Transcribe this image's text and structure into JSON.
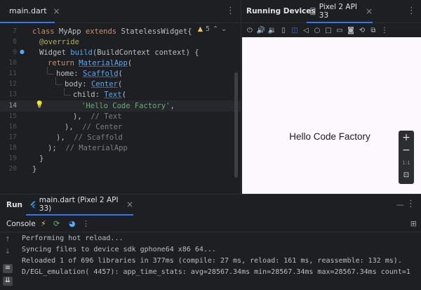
{
  "editor": {
    "tab_label": "main.dart",
    "warnings_count": "5",
    "line_numbers": [
      "7",
      "8",
      "9",
      "10",
      "11",
      "12",
      "13",
      "14",
      "15",
      "16",
      "17",
      "18",
      "19",
      "20"
    ],
    "current_line": "14",
    "lines": {
      "l7_kw1": "class",
      "l7_name": " MyApp ",
      "l7_kw2": "extends",
      "l7_rest": " StatelessWidget{",
      "l8": "@override",
      "l9_a": "Widget ",
      "l9_fn": "build",
      "l9_b": "(BuildContext context) {",
      "l10_kw": "return",
      "l10_cls": "MaterialApp",
      "l10_p": "(",
      "l11_name": "home: ",
      "l11_cls": "Scaffold",
      "l11_p": "(",
      "l12_name": "body: ",
      "l12_cls": "Center",
      "l12_p": "(",
      "l13_name": "child: ",
      "l13_cls": "Text",
      "l13_p": "(",
      "l14_str": "'Hello Code Factory'",
      "l14_p": ",",
      "l15_p": "),",
      "l15_c": "// Text",
      "l16_p": "),",
      "l16_c": "// Center",
      "l17_p": "),",
      "l17_c": "// Scaffold",
      "l18_p": ");",
      "l18_c": "// MaterialApp",
      "l19": "}",
      "l20": "}"
    }
  },
  "devices": {
    "title": "Running Devices",
    "tab_label": "Pixel 2 API 33",
    "toolbar_icons": [
      "power-icon",
      "volume-up-icon",
      "volume-down-icon",
      "rotate-left-icon",
      "rotate-right-icon",
      "back-icon",
      "home-icon",
      "overview-icon",
      "screenshot-icon",
      "camera-icon",
      "snapshot-icon",
      "resize-icon",
      "more-icon"
    ],
    "app_text": "Hello Code Factory",
    "zoom": {
      "zoom_in": "+",
      "zoom_out": "−",
      "ratio": "1:1"
    }
  },
  "run": {
    "title": "Run",
    "tab_label": "main.dart (Pixel 2 API 33)",
    "console_label": "Console",
    "lines": [
      "Performing hot reload...",
      "Syncing files to device sdk gphone64 x86 64...",
      "Reloaded 1 of 696 libraries in 377ms (compile: 27 ms, reload: 161 ms, reassemble: 132 ms).",
      "D/EGL_emulation( 4457): app_time_stats: avg=28567.34ms min=28567.34ms max=28567.34ms count=1"
    ]
  }
}
